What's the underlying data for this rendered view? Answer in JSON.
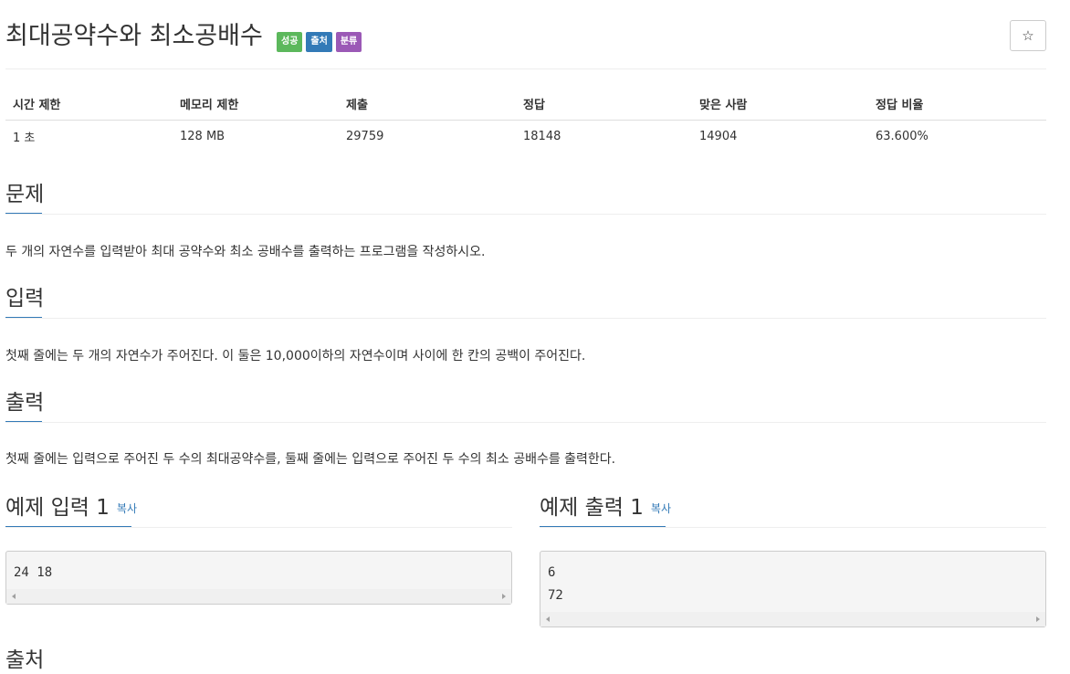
{
  "problem": {
    "title": "최대공약수와 최소공배수",
    "badges": [
      {
        "label": "성공",
        "color": "#5cb85c"
      },
      {
        "label": "출처",
        "color": "#337ab7"
      },
      {
        "label": "분류",
        "color": "#9b59b6"
      }
    ],
    "star_icon": "☆"
  },
  "info_table": {
    "headers": [
      "시간 제한",
      "메모리 제한",
      "제출",
      "정답",
      "맞은 사람",
      "정답 비율"
    ],
    "values": [
      "1 초",
      "128 MB",
      "29759",
      "18148",
      "14904",
      "63.600%"
    ]
  },
  "sections": {
    "description": {
      "title": "문제",
      "text": "두 개의 자연수를 입력받아 최대 공약수와 최소 공배수를 출력하는 프로그램을 작성하시오."
    },
    "input": {
      "title": "입력",
      "text": "첫째 줄에는 두 개의 자연수가 주어진다. 이 둘은 10,000이하의 자연수이며 사이에 한 칸의 공백이 주어진다."
    },
    "output": {
      "title": "출력",
      "text": "첫째 줄에는 입력으로 주어진 두 수의 최대공약수를, 둘째 줄에는 입력으로 주어진 두 수의 최소 공배수를 출력한다."
    }
  },
  "samples": {
    "input": {
      "title": "예제 입력 1",
      "copy_label": "복사",
      "lines": [
        "24 18"
      ]
    },
    "output": {
      "title": "예제 출력 1",
      "copy_label": "복사",
      "lines": [
        "6",
        "72"
      ]
    }
  },
  "next_section": {
    "title": "출처"
  },
  "colors": {
    "accent": "#337ab7",
    "success": "#5cb85c",
    "purple": "#9b59b6"
  }
}
